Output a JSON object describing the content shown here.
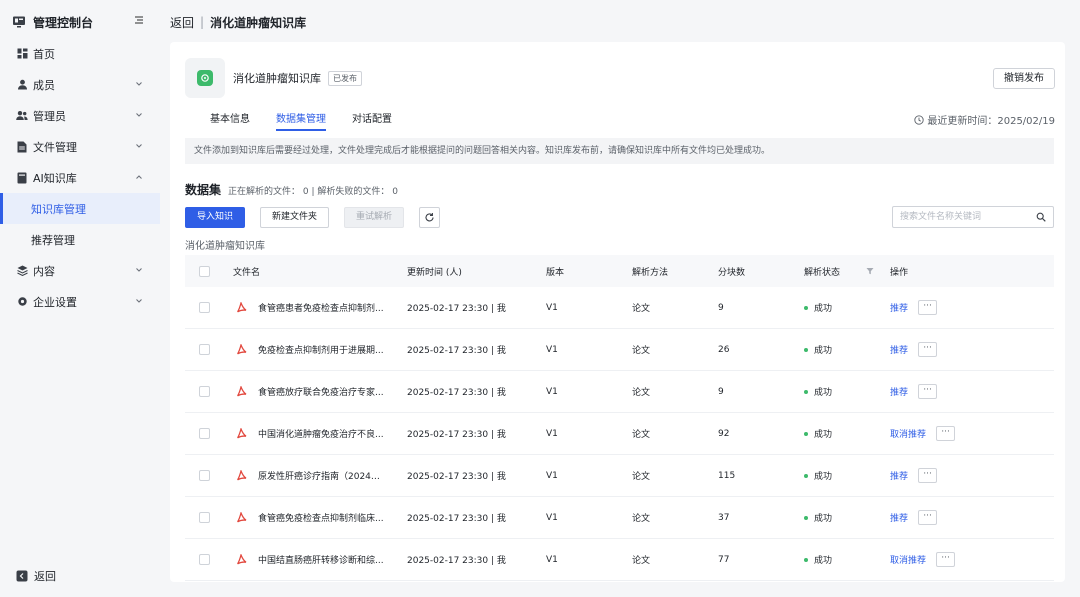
{
  "sidebar": {
    "brand_title": "管理控制台",
    "items": [
      {
        "label": "首页",
        "icon": "home-grid-icon"
      },
      {
        "label": "成员",
        "icon": "user-icon",
        "expandable": true
      },
      {
        "label": "管理员",
        "icon": "admin-users-icon",
        "expandable": true
      },
      {
        "label": "文件管理",
        "icon": "file-icon",
        "expandable": true
      },
      {
        "label": "AI知识库",
        "icon": "book-icon",
        "expandable": true,
        "expanded": true
      },
      {
        "label": "知识库管理",
        "sub": true,
        "active": true
      },
      {
        "label": "推荐管理",
        "sub": true
      },
      {
        "label": "内容",
        "icon": "layers-icon",
        "expandable": true
      },
      {
        "label": "企业设置",
        "icon": "settings-icon",
        "expandable": true
      }
    ],
    "bottom_label": "返回"
  },
  "header": {
    "back_label": "返回",
    "separator": "|",
    "title": "消化道肿瘤知识库"
  },
  "kb": {
    "name": "消化道肿瘤知识库",
    "badge": "已发布",
    "unpublish_label": "撤销发布"
  },
  "tabs": [
    {
      "label": "基本信息",
      "active": false
    },
    {
      "label": "数据集管理",
      "active": true
    },
    {
      "label": "对话配置",
      "active": false
    }
  ],
  "updated": "最近更新时间：2025/02/19",
  "notice": "文件添加到知识库后需要经过处理，文件处理完成后才能根据提问的问题回答相关内容。知识库发布前，请确保知识库中所有文件均已处理成功。",
  "dataset": {
    "title": "数据集",
    "status": "正在解析的文件： 0 | 解析失败的文件： 0"
  },
  "toolbar": {
    "import_label": "导入知识",
    "new_folder_label": "新建文件夹",
    "retry_label": "重试解析",
    "search_placeholder": "搜索文件名称关键词"
  },
  "crumb": "消化道肿瘤知识库",
  "table": {
    "headers": {
      "name": "文件名",
      "time": "更新时间 (人)",
      "version": "版本",
      "method": "解析方法",
      "chunks": "分块数",
      "status": "解析状态",
      "ops": "操作"
    },
    "rows": [
      {
        "name": "食管癌患者免疫检查点抑制剂...",
        "time": "2025-02-17 23:30 | 我",
        "version": "V1",
        "method": "论文",
        "chunks": "9",
        "status": "成功",
        "op": "推荐"
      },
      {
        "name": "免疫检查点抑制剂用于进展期...",
        "time": "2025-02-17 23:30 | 我",
        "version": "V1",
        "method": "论文",
        "chunks": "26",
        "status": "成功",
        "op": "推荐"
      },
      {
        "name": "食管癌放疗联合免疫治疗专家...",
        "time": "2025-02-17 23:30 | 我",
        "version": "V1",
        "method": "论文",
        "chunks": "9",
        "status": "成功",
        "op": "推荐"
      },
      {
        "name": "中国消化道肿瘤免疫治疗不良...",
        "time": "2025-02-17 23:30 | 我",
        "version": "V1",
        "method": "论文",
        "chunks": "92",
        "status": "成功",
        "op": "取消推荐"
      },
      {
        "name": "原发性肝癌诊疗指南（2024年...",
        "time": "2025-02-17 23:30 | 我",
        "version": "V1",
        "method": "论文",
        "chunks": "115",
        "status": "成功",
        "op": "推荐"
      },
      {
        "name": "食管癌免疫检查点抑制剂临床...",
        "time": "2025-02-17 23:30 | 我",
        "version": "V1",
        "method": "论文",
        "chunks": "37",
        "status": "成功",
        "op": "推荐"
      },
      {
        "name": "中国结直肠癌肝转移诊断和综...",
        "time": "2025-02-17 23:30 | 我",
        "version": "V1",
        "method": "论文",
        "chunks": "77",
        "status": "成功",
        "op": "取消推荐"
      }
    ],
    "more_label": "···"
  },
  "colors": {
    "accent": "#2f5ee6",
    "success": "#3dba6b",
    "pdf_red": "#e2493f",
    "page_bg": "#f5f6f8"
  }
}
